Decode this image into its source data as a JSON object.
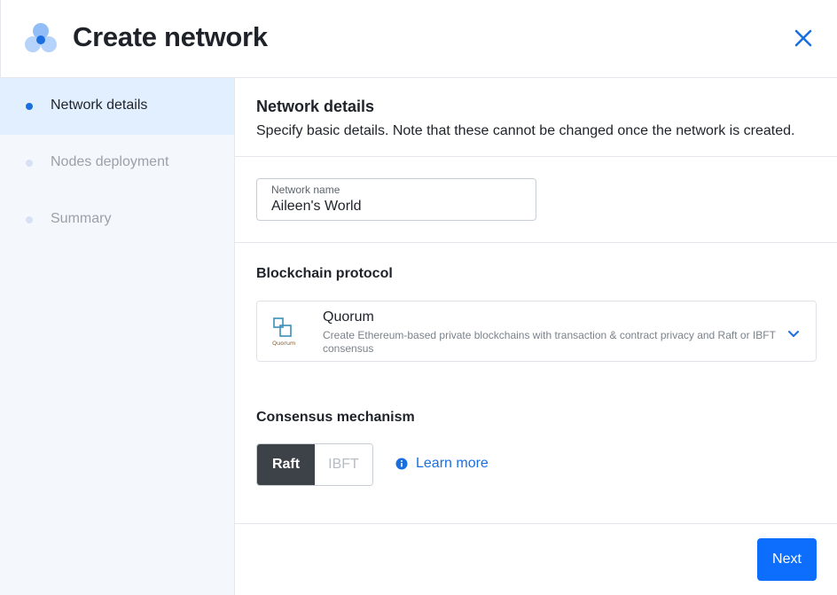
{
  "header": {
    "title": "Create network",
    "logo_icon": "network-logo-icon",
    "close_icon": "close-icon",
    "accent_color": "#1a6fe0"
  },
  "sidebar": {
    "steps": [
      {
        "label": "Network details",
        "active": true
      },
      {
        "label": "Nodes deployment",
        "active": false
      },
      {
        "label": "Summary",
        "active": false
      }
    ]
  },
  "main": {
    "section_title": "Network details",
    "section_description": "Specify basic details. Note that these cannot be changed once the network is created.",
    "network_name": {
      "label": "Network name",
      "value": "Aileen's World"
    },
    "protocol": {
      "label": "Blockchain protocol",
      "selected_name": "Quorum",
      "selected_logo_text": "Quorum",
      "selected_description": "Create Ethereum-based private blockchains with transaction & contract privacy and Raft or IBFT consensus"
    },
    "consensus": {
      "label": "Consensus mechanism",
      "options": [
        "Raft",
        "IBFT"
      ],
      "selected": "Raft",
      "learn_more": "Learn more"
    },
    "next_button": "Next"
  }
}
